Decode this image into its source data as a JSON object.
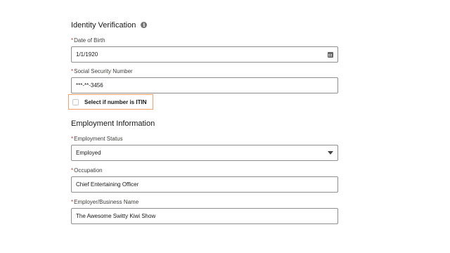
{
  "identity": {
    "title": "Identity Verification",
    "dob": {
      "required_mark": "*",
      "label": "Date of Birth",
      "value": "1/1/1920"
    },
    "ssn": {
      "required_mark": "*",
      "label": "Social Security Number",
      "value": "***-**-3456"
    },
    "itin": {
      "label": "Select if number is ITIN",
      "checked": false
    }
  },
  "employment": {
    "title": "Employment Information",
    "status": {
      "required_mark": "*",
      "label": "Employment Status",
      "value": "Employed"
    },
    "occupation": {
      "required_mark": "*",
      "label": "Occupation",
      "value": "Chief Entertaining Officer"
    },
    "employer": {
      "required_mark": "*",
      "label": "Employer/Business Name",
      "value": "The Awesome Switty Kiwi Show"
    }
  },
  "icons": {
    "info": "info-icon",
    "calendar": "calendar-icon",
    "dropdown": "chevron-down-icon"
  },
  "colors": {
    "required": "#c23934",
    "focus_outline": "#f4a068",
    "field_border": "#8e8e8e"
  }
}
